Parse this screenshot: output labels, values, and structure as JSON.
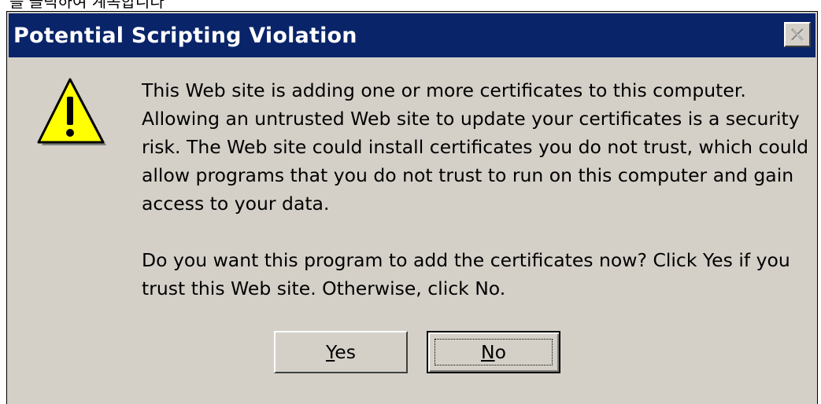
{
  "caption": "를 클릭하여 계속합니다",
  "dialog": {
    "title": "Potential Scripting Violation",
    "close_icon": "close-icon",
    "warning_icon": "warning-icon",
    "message_paragraphs": [
      "This Web site is adding one or more certificates to this computer. Allowing an untrusted Web site to update your certificates is a security risk. The Web site could install certificates you do not trust, which could allow programs that you do not trust to run on this computer and gain access to your data.",
      "Do you want this program to add the certificates now? Click Yes if you trust this Web site. Otherwise, click No."
    ],
    "buttons": {
      "yes": {
        "accel": "Y",
        "rest": "es"
      },
      "no": {
        "accel": "N",
        "rest": "o"
      }
    }
  },
  "colors": {
    "titlebar": "#0a246a",
    "dialog_bg": "#d4d0c8",
    "warning_yellow": "#ffff00"
  }
}
